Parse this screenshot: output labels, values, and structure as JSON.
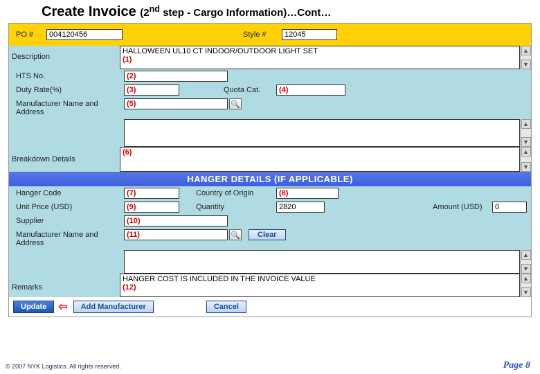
{
  "title": {
    "main": "Create Invoice ",
    "sub": "(2",
    "sup": "nd",
    "sub2": " step - Cargo Information)…Cont…"
  },
  "cargo": {
    "po_label": "PO #",
    "po_value": "004120456",
    "style_label": "Style #",
    "style_value": "12045",
    "desc_label": "Description",
    "desc_value": "HALLOWEEN UL10 CT INDOOR/OUTDOOR LIGHT SET",
    "desc_mark": "(1)",
    "hts_label": "HTS No.",
    "hts_mark": "(2)",
    "duty_label": "Duty Rate(%)",
    "duty_mark": "(3)",
    "quota_label": "Quota Cat.",
    "quota_mark": "(4)",
    "mfr_label": "Manufacturer Name and Address",
    "mfr_mark": "(5)",
    "breakdown_label": "Breakdown Details",
    "breakdown_mark": "(6)"
  },
  "hanger": {
    "section_head": "HANGER DETAILS (IF APPLICABLE)",
    "code_label": "Hanger Code",
    "code_mark": "(7)",
    "country_label": "Country of Origin",
    "country_mark": "(8)",
    "unitprice_label": "Unit Price (USD)",
    "unitprice_mark": "(9)",
    "qty_label": "Quantity",
    "qty_value": "2820",
    "amount_label": "Amount (USD)",
    "amount_value": "0",
    "supplier_label": "Supplier",
    "supplier_mark": "(10)",
    "mfr_label": "Manufacturer Name and Address",
    "mfr_mark": "(11)",
    "remarks_label": "Remarks",
    "remarks_value": "HANGER COST IS INCLUDED IN THE INVOICE VALUE",
    "remarks_mark": "(12)",
    "clear_label": "Clear"
  },
  "buttons": {
    "update": "Update",
    "add_mfr": "Add Manufacturer",
    "cancel": "Cancel"
  },
  "footer": {
    "copyright": "© 2007 NYK Logistics. All rights reserved.",
    "pagenum": "Page 8"
  }
}
